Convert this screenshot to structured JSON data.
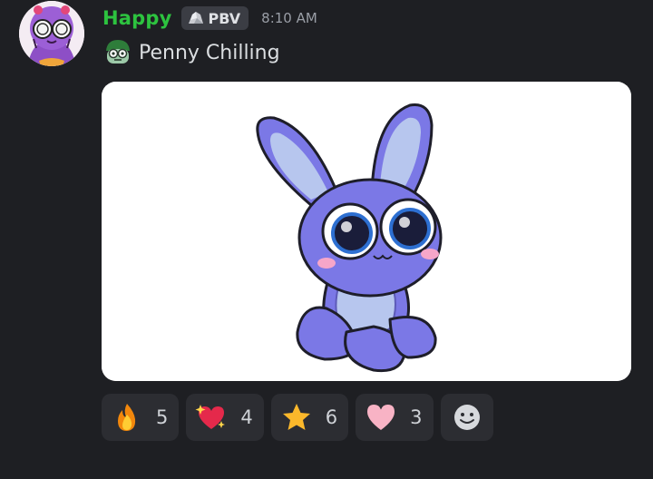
{
  "author": {
    "username": "Happy",
    "username_color": "#2dc33f",
    "tag": {
      "icon": "rock-icon",
      "label": "PBV"
    },
    "timestamp": "8:10 AM"
  },
  "message": {
    "emoji": "zombie-face-icon",
    "text": "Penny Chilling"
  },
  "reactions": [
    {
      "icon": "fire-icon",
      "count": "5"
    },
    {
      "icon": "sparkling-heart-icon",
      "count": "4"
    },
    {
      "icon": "star-icon",
      "count": "6"
    },
    {
      "icon": "pink-heart-icon",
      "count": "3"
    }
  ],
  "add_reaction_icon": "add-reaction-icon",
  "colors": {
    "background": "#1e1f23",
    "reaction_bg": "#2c2d32",
    "text": "#dbdee1",
    "muted": "#9a9ea6"
  }
}
